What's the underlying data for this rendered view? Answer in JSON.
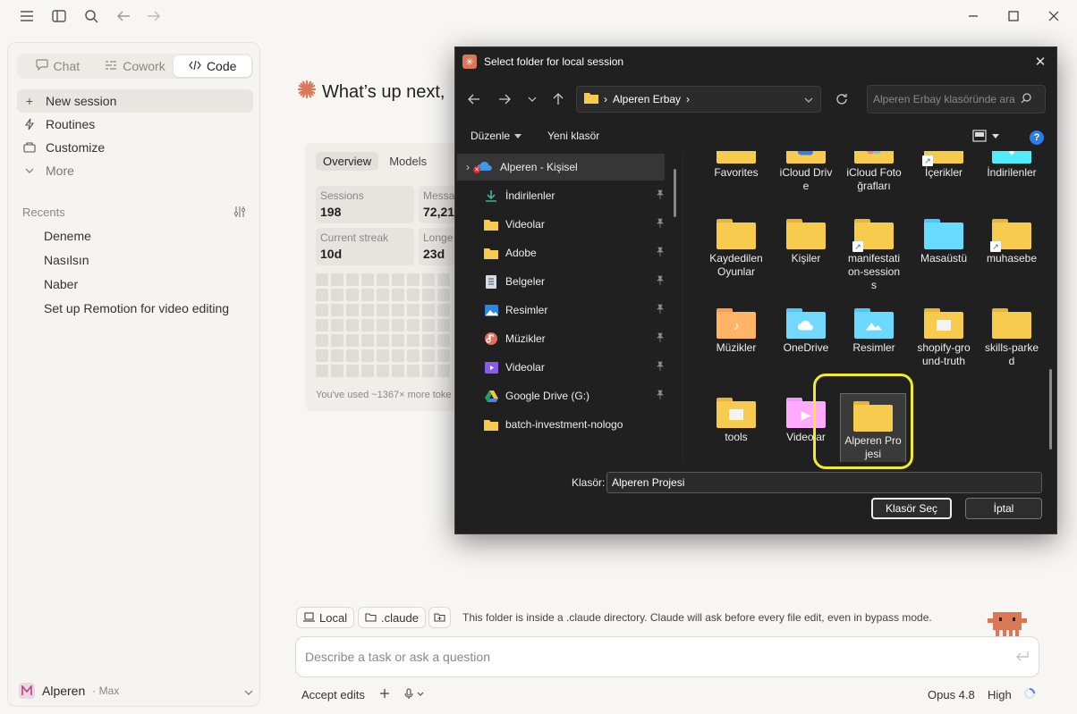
{
  "sidebar": {
    "modes": [
      {
        "label": "Chat",
        "icon": "chat-icon"
      },
      {
        "label": "Cowork",
        "icon": "cowork-icon"
      },
      {
        "label": "Code",
        "icon": "code-icon",
        "active": true
      }
    ],
    "nav": {
      "new_session": "New session",
      "routines": "Routines",
      "customize": "Customize",
      "more": "More"
    },
    "recents_label": "Recents",
    "recents": [
      "Deneme",
      "Nasılsın",
      "Naber",
      "Set up Remotion for video editing"
    ],
    "user": {
      "name": "Alperen",
      "plan": "· Max"
    }
  },
  "main": {
    "greeting": "What’s up next,",
    "stats": {
      "tabs": [
        "Overview",
        "Models"
      ],
      "cards": [
        {
          "label": "Sessions",
          "value": "198"
        },
        {
          "label": "Messa",
          "value": "72,21"
        },
        {
          "label": "Current streak",
          "value": "10d"
        },
        {
          "label": "Longe",
          "value": "23d"
        }
      ],
      "note": "You've used ~1367× more toke"
    },
    "chips": {
      "local": "Local",
      "claude": ".claude"
    },
    "folder_note": "This folder is inside a .claude directory. Claude will ask before every file edit, even in bypass mode.",
    "task_placeholder": "Describe a task or ask a question",
    "bottom": {
      "accept": "Accept edits",
      "model": "Opus 4.8",
      "effort": "High"
    }
  },
  "dialog": {
    "title": "Select folder for local session",
    "path": "Alperen Erbay",
    "search_placeholder": "Alperen Erbay klasöründe ara",
    "commands": {
      "organize": "Düzenle",
      "new_folder": "Yeni klasör"
    },
    "nav_items": [
      {
        "label": "Alperen - Kişisel",
        "icon": "onedrive-icon",
        "pinned": false
      },
      {
        "label": "İndirilenler",
        "icon": "download-icon",
        "pinned": true
      },
      {
        "label": "Videolar",
        "icon": "folder-icon",
        "pinned": true
      },
      {
        "label": "Adobe",
        "icon": "folder-icon",
        "pinned": true
      },
      {
        "label": "Belgeler",
        "icon": "documents-icon",
        "pinned": true
      },
      {
        "label": "Resimler",
        "icon": "pictures-icon",
        "pinned": true
      },
      {
        "label": "Müzikler",
        "icon": "music-icon",
        "pinned": true
      },
      {
        "label": "Videolar",
        "icon": "videos-icon",
        "pinned": true
      },
      {
        "label": "Google Drive (G:)",
        "icon": "google-drive-icon",
        "pinned": true
      },
      {
        "label": "batch-investment-nologo",
        "icon": "folder-icon",
        "pinned": false
      }
    ],
    "files": [
      {
        "label": "Favorites"
      },
      {
        "label": "iCloud Drive"
      },
      {
        "label": "iCloud Fotoğrafları"
      },
      {
        "label": "İçerikler"
      },
      {
        "label": "İndirilenler"
      },
      {
        "label": "Kaydedilen Oyunlar"
      },
      {
        "label": "Kişiler"
      },
      {
        "label": "manifestation-sessions"
      },
      {
        "label": "Masaüstü"
      },
      {
        "label": "muhasebe"
      },
      {
        "label": "Müzikler"
      },
      {
        "label": "OneDrive"
      },
      {
        "label": "Resimler"
      },
      {
        "label": "shopify-ground-truth"
      },
      {
        "label": "skills-parked"
      },
      {
        "label": "tools"
      },
      {
        "label": "Videolar"
      },
      {
        "label": "Alperen Projesi"
      }
    ],
    "folder_label": "Klasör:",
    "folder_value": "Alperen Projesi",
    "select_button": "Klasör Seç",
    "cancel_button": "İptal"
  },
  "colors": {
    "accent": "#d97757",
    "highlight": "#f3ea28",
    "dialog_bg": "#202020"
  }
}
